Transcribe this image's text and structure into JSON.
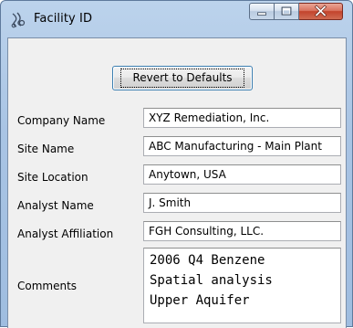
{
  "window": {
    "title": "Facility ID",
    "app_icon": "facility-app-icon",
    "caption_buttons": [
      "minimize-icon",
      "maximize-icon",
      "close-icon"
    ]
  },
  "actions": {
    "revert_label": "Revert to Defaults"
  },
  "fields": [
    {
      "label": "Company Name",
      "value": "XYZ Remediation, Inc."
    },
    {
      "label": "Site Name",
      "value": "ABC Manufacturing - Main Plant"
    },
    {
      "label": "Site Location",
      "value": "Anytown, USA"
    },
    {
      "label": "Analyst Name",
      "value": "J. Smith"
    },
    {
      "label": "Analyst Affiliation",
      "value": "FGH Consulting, LLC."
    }
  ],
  "comments": {
    "label": "Comments",
    "value": "2006 Q4 Benzene\nSpatial analysis\nUpper Aquifer"
  }
}
